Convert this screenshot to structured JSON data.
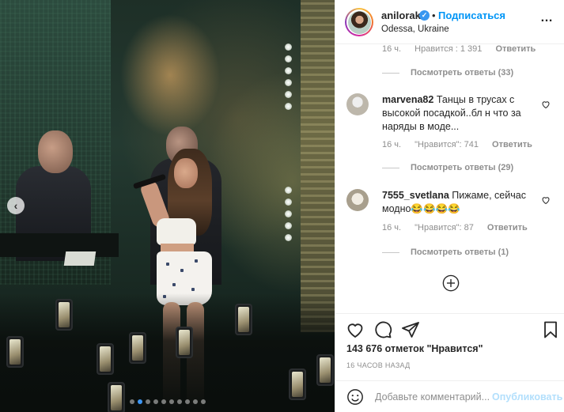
{
  "post": {
    "username": "anilorak",
    "follow_separator": "•",
    "follow_label": "Подписаться",
    "location": "Odessa, Ukraine",
    "more_icon": "ellipsis-icon",
    "verified_icon": "verified-badge-icon"
  },
  "colors": {
    "accent": "#0095f6",
    "muted": "#8e8e8e",
    "text": "#262626",
    "publish_disabled": "#b2dffc",
    "carousel_dot_active": "#3d96f3"
  },
  "carousel": {
    "prev_icon": "chevron-left-icon",
    "dot_count": 10,
    "active_dot": 1
  },
  "comments": {
    "top_meta": {
      "time": "16 ч.",
      "likes": "Нравится : 1 391",
      "reply": "Ответить"
    },
    "top_view_replies": "Посмотреть ответы (33)",
    "items": [
      {
        "username": "marvena82",
        "text": "Танцы в трусах с высокой посадкой..бл н что за наряды в моде...",
        "time": "16 ч.",
        "likes": "\"Нравится\": 741",
        "reply": "Ответить",
        "view_replies": "Посмотреть ответы (29)",
        "avatar_color": "#c9c5bc"
      },
      {
        "username": "7555_svetlana",
        "text": "Пижаме, сейчас модно😂😂😂😂",
        "time": "16 ч.",
        "likes": "\"Нравится\": 87",
        "reply": "Ответить",
        "view_replies": "Посмотреть ответы (1)",
        "avatar_color": "#d8d2c6"
      }
    ],
    "load_more_icon": "plus-circle-icon"
  },
  "actions": {
    "like_icon": "heart-icon",
    "comment_icon": "comment-icon",
    "share_icon": "paper-plane-icon",
    "save_icon": "bookmark-icon",
    "likes_text": "143 676 отметок \"Нравится\"",
    "time_ago": "16 ЧАСОВ НАЗАД"
  },
  "comment_box": {
    "emoji_icon": "emoji-icon",
    "placeholder": "Добавьте комментарий...",
    "publish_label": "Опубликовать"
  }
}
